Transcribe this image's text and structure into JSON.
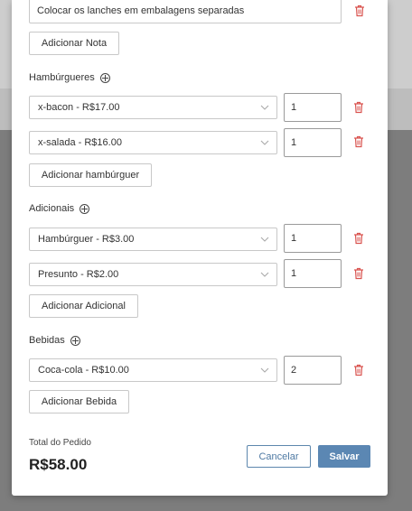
{
  "note": {
    "value": "Colocar os lanches em embalagens separadas"
  },
  "add_note_label": "Adicionar Nota",
  "hamburgueres": {
    "title": "Hambúrgueres",
    "items": [
      {
        "name": "x-bacon - R$17.00",
        "qty": "1"
      },
      {
        "name": "x-salada - R$16.00",
        "qty": "1"
      }
    ],
    "add_label": "Adicionar hambúrguer"
  },
  "adicionais": {
    "title": "Adicionais",
    "items": [
      {
        "name": "Hambúrguer - R$3.00",
        "qty": "1"
      },
      {
        "name": "Presunto - R$2.00",
        "qty": "1"
      }
    ],
    "add_label": "Adicionar Adicional"
  },
  "bebidas": {
    "title": "Bebidas",
    "items": [
      {
        "name": "Coca-cola - R$10.00",
        "qty": "2"
      }
    ],
    "add_label": "Adicionar Bebida"
  },
  "total": {
    "label": "Total do Pedido",
    "value": "R$58.00"
  },
  "actions": {
    "cancel": "Cancelar",
    "save": "Salvar"
  },
  "colors": {
    "accent": "#5b87b3",
    "danger": "#d9534f"
  },
  "icons": {
    "delete": "trash-icon",
    "add": "plus-circle-icon",
    "dropdown": "chevron-down-icon"
  }
}
